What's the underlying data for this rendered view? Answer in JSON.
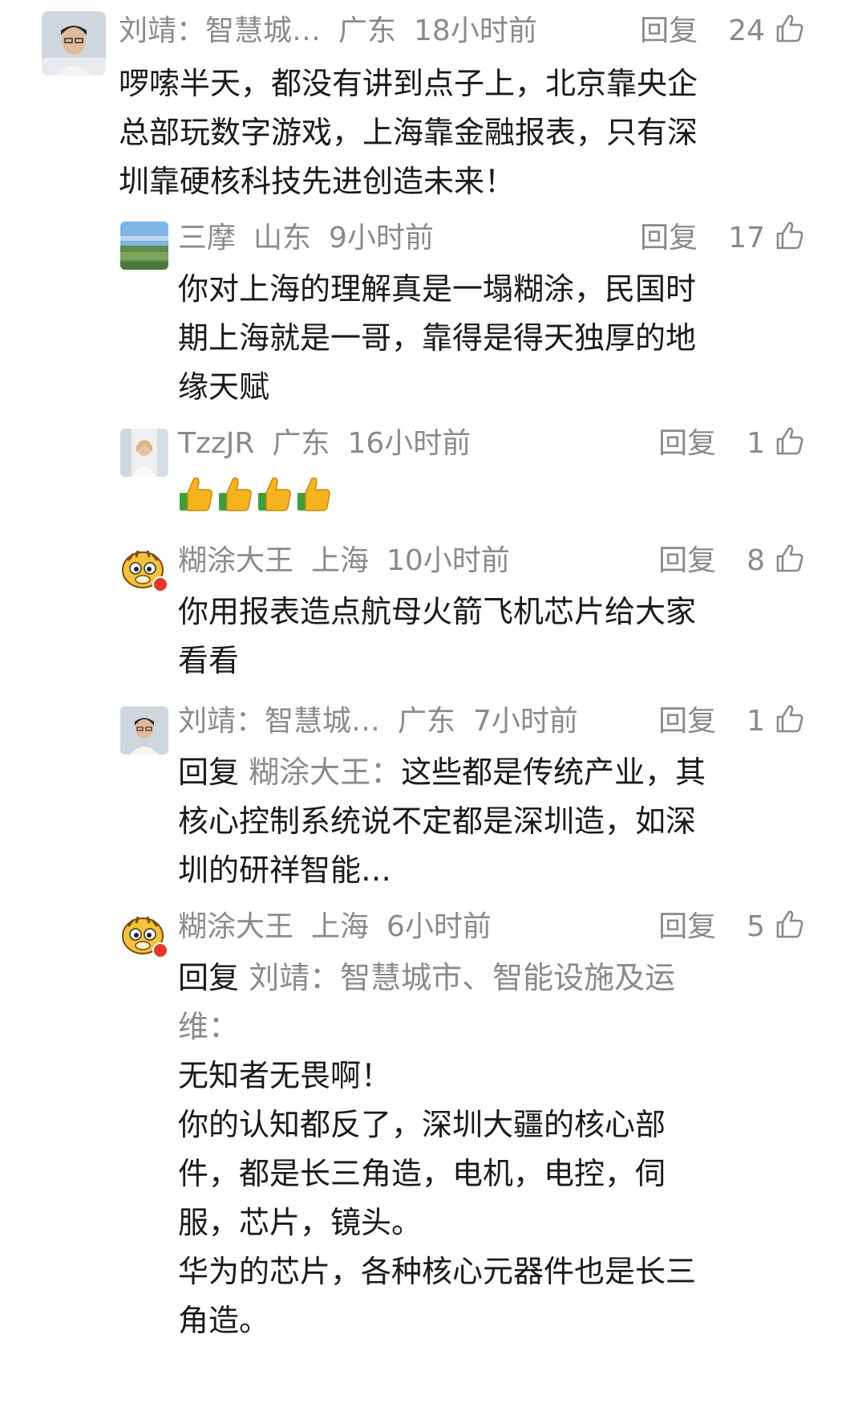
{
  "comments": [
    {
      "user": "刘靖：智慧城…",
      "location": "广东",
      "time": "18小时前",
      "reply": "回复",
      "likes": "24",
      "text": "啰嗦半天，都没有讲到点子上，北京靠央企总部玩数字游戏，上海靠金融报表，只有深圳靠硬核科技先进创造未来！"
    },
    {
      "user": "三摩",
      "location": "山东",
      "time": "9小时前",
      "reply": "回复",
      "likes": "17",
      "text": "你对上海的理解真是一塌糊涂，民国时期上海就是一哥，靠得是得天独厚的地缘天赋"
    },
    {
      "user": "TzzJR",
      "location": "广东",
      "time": "16小时前",
      "reply": "回复",
      "likes": "1",
      "emoji": "thumbs-up-emoji x4"
    },
    {
      "user": "糊涂大王",
      "location": "上海",
      "time": "10小时前",
      "reply": "回复",
      "likes": "8",
      "text": "你用报表造点航母火箭飞机芯片给大家看看"
    },
    {
      "user": "刘靖：智慧城…",
      "location": "广东",
      "time": "7小时前",
      "reply": "回复",
      "likes": "1",
      "reply_prefix": "回复",
      "reply_to": "糊涂大王：",
      "text": "这些都是传统产业，其核心控制系统说不定都是深圳造，如深圳的研祥智能…"
    },
    {
      "user": "糊涂大王",
      "location": "上海",
      "time": "6小时前",
      "reply": "回复",
      "likes": "5",
      "reply_prefix": "回复",
      "reply_to": "刘靖：智慧城市、智能设施及运维：",
      "text": "无知者无畏啊！",
      "text2": "你的认知都反了，深圳大疆的核心部件，都是长三角造，电机，电控，伺服，芯片，镜头。",
      "text3": "华为的芯片，各种核心元器件也是长三角造。"
    }
  ],
  "colors": {
    "meta": "#8a8a8a",
    "text": "#1a1a1a",
    "background": "#ffffff"
  }
}
